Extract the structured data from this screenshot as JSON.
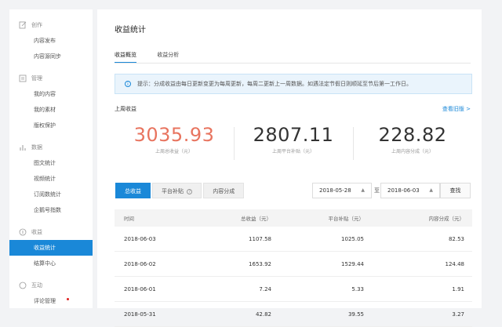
{
  "sidebar": {
    "sections": [
      {
        "label": "创作",
        "icon": "edit-icon",
        "items": [
          {
            "label": "内容发布",
            "active": false
          },
          {
            "label": "内容源同步",
            "active": false
          }
        ]
      },
      {
        "label": "管理",
        "icon": "manage-icon",
        "items": [
          {
            "label": "我的内容",
            "active": false
          },
          {
            "label": "我的素材",
            "active": false
          },
          {
            "label": "版权保护",
            "active": false
          }
        ]
      },
      {
        "label": "数据",
        "icon": "chart-icon",
        "items": [
          {
            "label": "图文统计",
            "active": false
          },
          {
            "label": "视频统计",
            "active": false
          },
          {
            "label": "订阅数统计",
            "active": false
          },
          {
            "label": "企鹅号指数",
            "active": false
          }
        ]
      },
      {
        "label": "收益",
        "icon": "coin-icon",
        "items": [
          {
            "label": "收益统计",
            "active": true
          },
          {
            "label": "结算中心",
            "active": false
          }
        ]
      },
      {
        "label": "互动",
        "icon": "chat-icon",
        "items": [
          {
            "label": "评论管理",
            "active": false,
            "dot": true
          }
        ]
      }
    ]
  },
  "main": {
    "title": "收益统计",
    "tabs": [
      "收益概览",
      "收益分析"
    ],
    "notice": "提示：分成收益由每日更新变更为每周更新，每周二更新上一周数据。如遇法定节假日则顺延至节后第一工作日。",
    "week_label": "上周收益",
    "old_link": "查看旧版 >",
    "stats": [
      {
        "value": "3035.93",
        "label": "上周总收益（元）"
      },
      {
        "value": "2807.11",
        "label": "上周平台补贴（元）"
      },
      {
        "value": "228.82",
        "label": "上周内容分成（元）"
      }
    ],
    "filter_tabs": [
      "总收益",
      "平台补贴",
      "内容分成"
    ],
    "date_from": "2018-05-28",
    "date_to": "2018-06-03",
    "to_label": "至",
    "query_label": "查找",
    "table": {
      "headers": [
        "时间",
        "总收益（元）",
        "平台补贴（元）",
        "内容分成（元）"
      ],
      "rows": [
        [
          "2018-06-03",
          "1107.58",
          "1025.05",
          "82.53"
        ],
        [
          "2018-06-02",
          "1653.92",
          "1529.44",
          "124.48"
        ],
        [
          "2018-06-01",
          "7.24",
          "5.33",
          "1.91"
        ],
        [
          "2018-05-31",
          "42.82",
          "39.55",
          "3.27"
        ]
      ]
    }
  },
  "colors": {
    "accent": "#1a88d8",
    "highlight_number": "#e8745f"
  }
}
